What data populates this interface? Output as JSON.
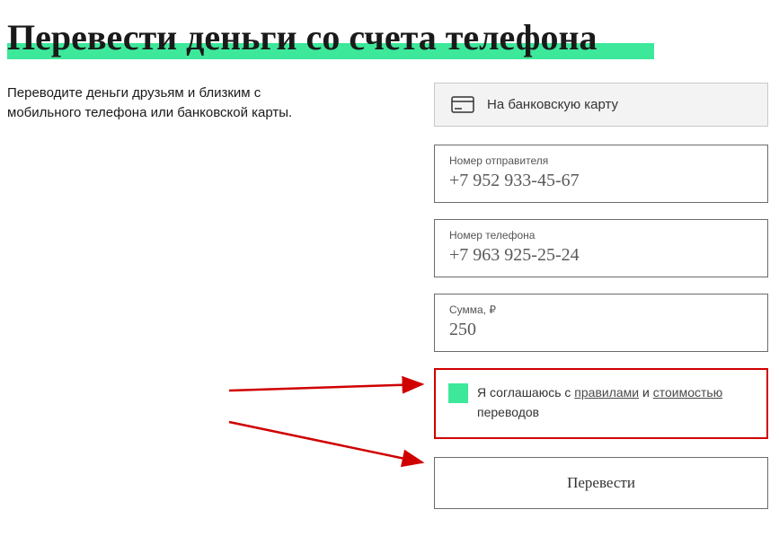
{
  "header": {
    "title": "Перевести деньги со счета телефона"
  },
  "description": "Переводите деньги друзьям и близким с мобильного телефона или банковской карты.",
  "tab": {
    "label": "На банковскую карту"
  },
  "fields": {
    "sender": {
      "label": "Номер отправителя",
      "value": "+7 952 933-45-67"
    },
    "phone": {
      "label": "Номер телефона",
      "value": "+7 963 925-25-24"
    },
    "amount": {
      "label": "Сумма, ₽",
      "value": "250"
    }
  },
  "agreement": {
    "prefix": "Я соглашаюсь с ",
    "link1": "правилами",
    "middle": " и ",
    "link2": "стоимостью",
    "suffix": " переводов"
  },
  "submit": {
    "label": "Перевести"
  }
}
